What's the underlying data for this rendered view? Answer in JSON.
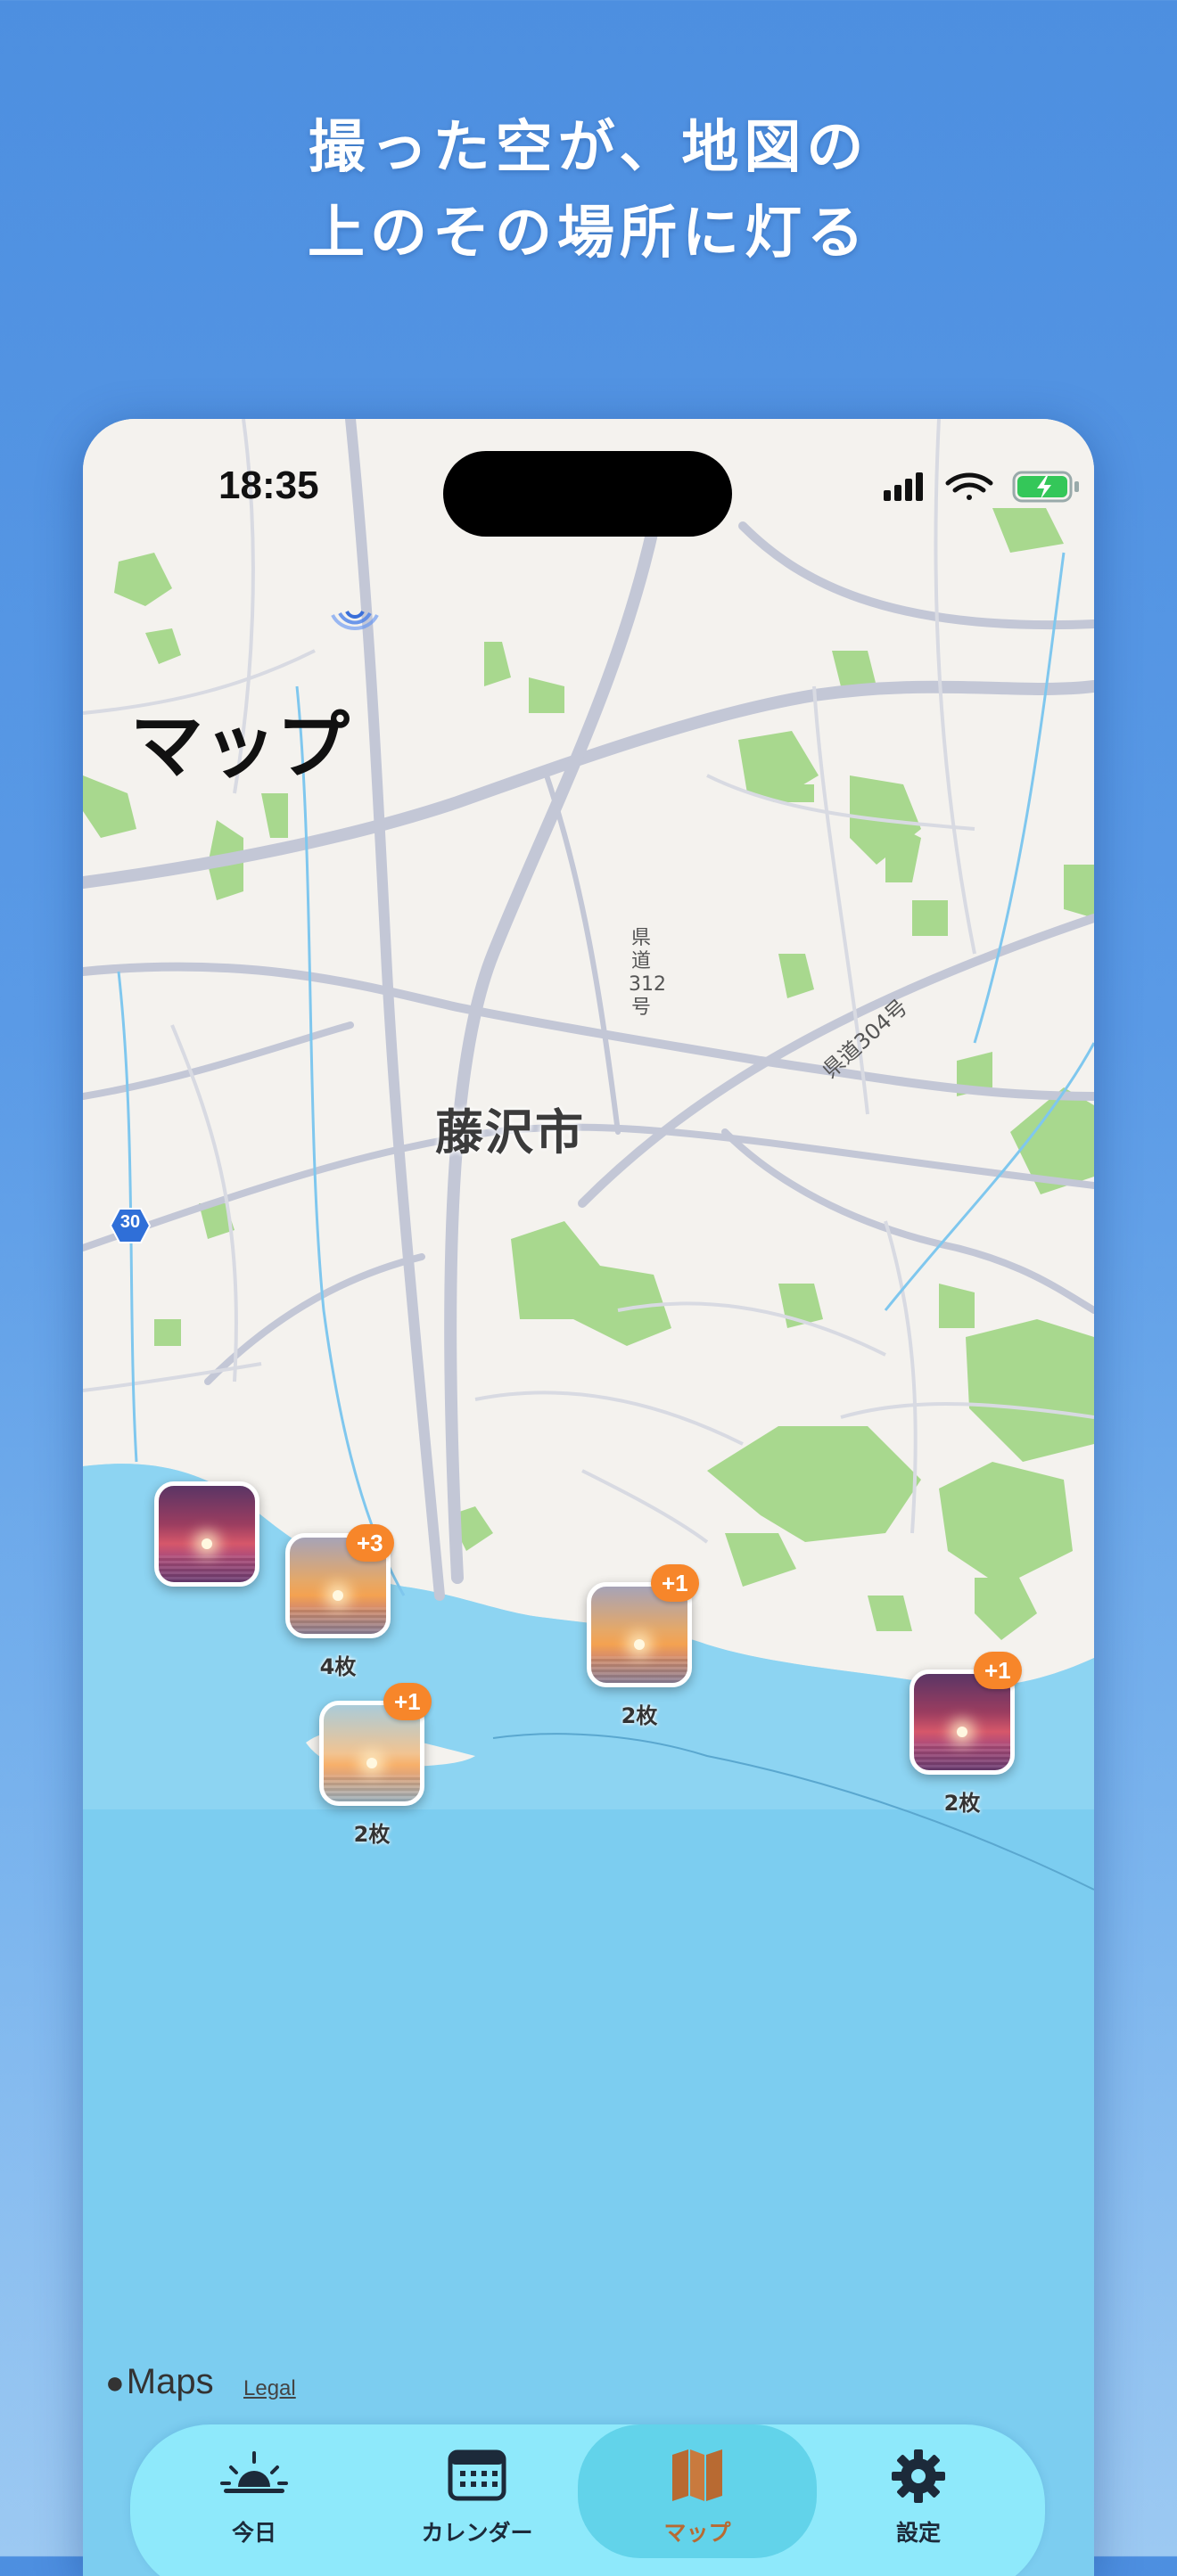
{
  "promo": {
    "line1": "撮った空が、地図の",
    "line2": "上のその場所に灯る"
  },
  "status_bar": {
    "time": "18:35",
    "icons": [
      "signal-icon",
      "wifi-icon",
      "battery-charging-icon"
    ]
  },
  "page": {
    "title": "マップ"
  },
  "map": {
    "city_label": "藤沢市",
    "road_label_vertical": "県道312号",
    "road_label_diagonal": "県道304号",
    "route_shield": "30",
    "attribution": "Maps",
    "legal": "Legal",
    "colors": {
      "sea": "#7ccdf0",
      "land": "#f4f2ee",
      "park": "#a8d88e",
      "road": "#c3c7d6"
    }
  },
  "pins": [
    {
      "style": "sunset",
      "badge": "",
      "count": ""
    },
    {
      "style": "warm",
      "badge": "+3",
      "count": "4枚"
    },
    {
      "style": "pale",
      "badge": "+1",
      "count": "2枚"
    },
    {
      "style": "warm",
      "badge": "+1",
      "count": "2枚"
    },
    {
      "style": "sunset",
      "badge": "+1",
      "count": "2枚"
    }
  ],
  "tabs": [
    {
      "label": "今日",
      "icon": "sunrise-icon",
      "active": false
    },
    {
      "label": "カレンダー",
      "icon": "calendar-icon",
      "active": false
    },
    {
      "label": "マップ",
      "icon": "map-icon",
      "active": true
    },
    {
      "label": "設定",
      "icon": "gear-icon",
      "active": false
    }
  ],
  "accent_colors": {
    "badge": "#f7862a",
    "tabbar": "#8ee9fb",
    "active_tab": "#62d3ea"
  }
}
